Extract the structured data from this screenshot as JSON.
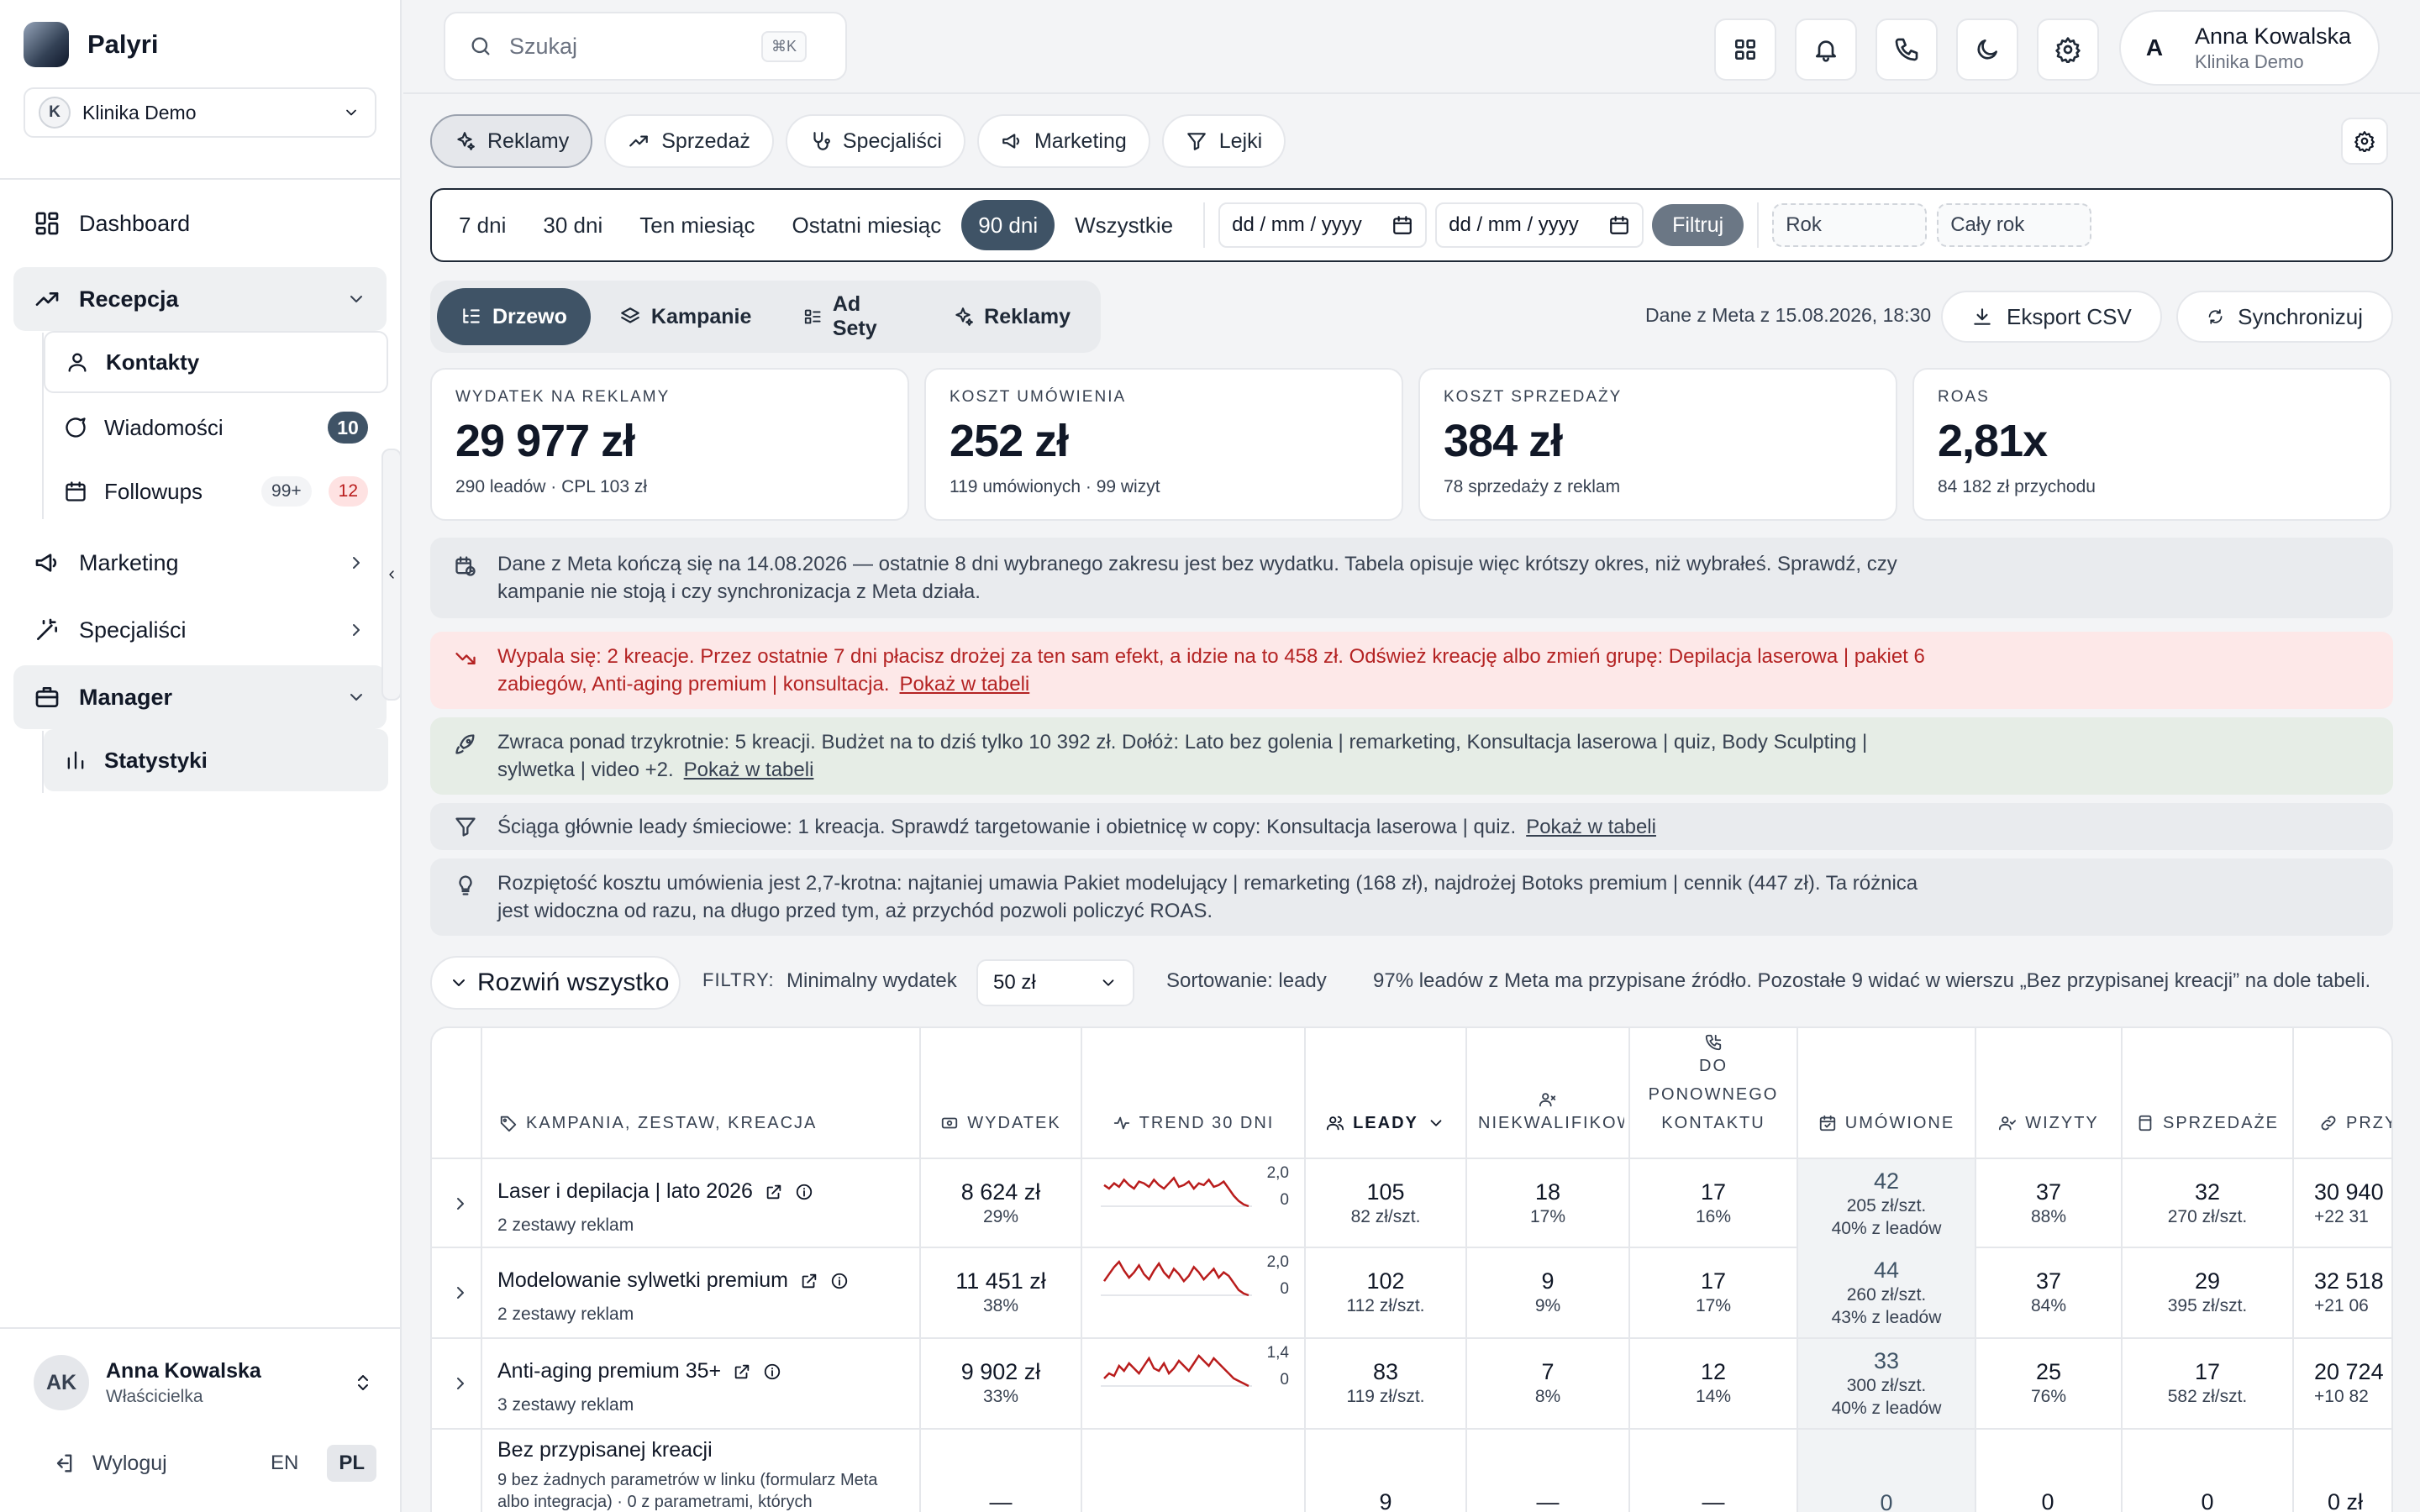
{
  "app": {
    "name": "Palyri",
    "clinic": "Klinika Demo",
    "clinic_initial": "K"
  },
  "sidebar": {
    "dashboard": "Dashboard",
    "recepcja": "Recepcja",
    "kontakty": "Kontakty",
    "wiadomosci": "Wiadomości",
    "wiadomosci_badge": "10",
    "followups": "Followups",
    "followups_badge_1": "99+",
    "followups_badge_2": "12",
    "marketing": "Marketing",
    "specjalisci": "Specjaliści",
    "manager": "Manager",
    "statystyki": "Statystyki",
    "user": {
      "initials": "AK",
      "name": "Anna Kowalska",
      "role": "Właścicielka"
    },
    "logout": "Wyloguj",
    "lang_en": "EN",
    "lang_pl": "PL"
  },
  "topbar": {
    "search_placeholder": "Szukaj",
    "search_kbd": "⌘K",
    "user_initial": "A",
    "user_name": "Anna Kowalska",
    "user_clinic": "Klinika Demo"
  },
  "section_tabs": [
    "Reklamy",
    "Sprzedaż",
    "Specjaliści",
    "Marketing",
    "Lejki"
  ],
  "date_filter": {
    "ranges": [
      "7 dni",
      "30 dni",
      "Ten miesiąc",
      "Ostatni miesiąc",
      "90 dni",
      "Wszystkie"
    ],
    "active_range": "90 dni",
    "date_from": "dd / mm / yyyy",
    "date_to": "dd / mm / yyyy",
    "filter_btn": "Filtruj",
    "year_placeholder": "Rok",
    "period_placeholder": "Cały rok"
  },
  "view_tabs": [
    "Drzewo",
    "Kampanie",
    "Ad Sety",
    "Reklamy"
  ],
  "meta_info": "Dane z Meta z 15.08.2026, 18:30",
  "export_btn": "Eksport CSV",
  "sync_btn": "Synchronizuj",
  "kpis": [
    {
      "title": "WYDATEK NA REKLAMY",
      "value": "29 977 zł",
      "sub": "290 leadów · CPL 103 zł"
    },
    {
      "title": "KOSZT UMÓWIENIA",
      "value": "252 zł",
      "sub": "119 umówionych · 99 wizyt"
    },
    {
      "title": "KOSZT SPRZEDAŻY",
      "value": "384 zł",
      "sub": "78 sprzedaży z reklam"
    },
    {
      "title": "ROAS",
      "value": "2,81x",
      "sub": "84 182 zł przychodu"
    }
  ],
  "alerts": {
    "meta_end": "Dane z Meta kończą się na 14.08.2026 — ostatnie 8 dni wybranego zakresu jest bez wydatku. Tabela opisuje więc krótszy okres, niż wybrałeś. Sprawdź, czy kampanie nie stoją i czy synchronizacja z Meta działa.",
    "burnout": "Wypala się: 2 kreacje. Przez ostatnie 7 dni płacisz drożej za ten sam efekt, a idzie na to 458 zł. Odśwież kreację albo zmień grupę: Depilacja laserowa | pakiet 6 zabiegów, Anti-aging premium | konsultacja.",
    "winners": "Zwraca ponad trzykrotnie: 5 kreacji. Budżet na to dziś tylko 10 392 zł. Dołóż: Lato bez golenia | remarketing, Konsultacja laserowa | quiz, Body Sculpting | sylwetka | video +2.",
    "junk": "Ściąga głównie leady śmieciowe: 1 kreacja. Sprawdź targetowanie i obietnicę w copy: Konsultacja laserowa | quiz.",
    "spread": "Rozpiętość kosztu umówienia jest 2,7-krotna: najtaniej umawia Pakiet modelujący | remarketing (168 zł), najdrożej Botoks premium | cennik (447 zł). Ta różnica jest widoczna od razu, na długo przed tym, aż przychód pozwoli policzyć ROAS.",
    "link": "Pokaż w tabeli"
  },
  "table_controls": {
    "expand_all": "Rozwiń wszystko",
    "filters_label": "FILTRY:",
    "min_spend_label": "Minimalny wydatek",
    "min_spend_value": "50 zł",
    "sorting": "Sortowanie: leady",
    "attribution_note": "97% leadów z Meta ma przypisane źródło. Pozostałe 9 widać w wierszu „Bez przypisanej kreacji” na dole tabeli."
  },
  "table": {
    "headers": {
      "name": "KAMPANIA, ZESTAW, KREACJA",
      "spend": "WYDATEK",
      "trend": "TREND 30 DNI",
      "leads": "LEADY",
      "unqualified": "NIEKWALIFIKOWA",
      "recontact": "DO PONOWNEGO KONTAKTU",
      "booked": "UMÓWIONE",
      "visits": "WIZYTY",
      "sales": "SPRZEDAŻE",
      "revenue": "PRZYCHÓD"
    },
    "rows": [
      {
        "name": "Laser i depilacja | lato 2026",
        "sub": "2 zestawy reklam",
        "spend": "8 624 zł",
        "spend_pct": "29%",
        "trend_max": "2,0",
        "trend_min": "0",
        "trend": [
          1.2,
          1.0,
          1.3,
          1.1,
          1.5,
          1.2,
          1.0,
          1.4,
          1.3,
          1.1,
          1.5,
          1.2,
          1.0,
          1.3,
          1.6,
          1.1,
          1.2,
          1.4,
          1.0,
          1.3,
          1.2,
          1.5,
          1.1,
          1.2,
          1.4,
          1.0,
          0.6,
          0.3,
          0.1,
          0.0
        ],
        "leads": "105",
        "leads_cpl": "82 zł/szt.",
        "unq": "18",
        "unq_pct": "17%",
        "rec": "17",
        "rec_pct": "16%",
        "booked": "42",
        "booked_cost": "205 zł/szt.",
        "booked_pct": "40% z leadów",
        "visits": "37",
        "visits_pct": "88%",
        "sales": "32",
        "sales_cost": "270 zł/szt.",
        "rev": "30 940",
        "rev_sub": "+22 31"
      },
      {
        "name": "Modelowanie sylwetki premium",
        "sub": "2 zestawy reklam",
        "spend": "11 451 zł",
        "spend_pct": "38%",
        "trend_max": "2,0",
        "trend_min": "0",
        "trend": [
          0.8,
          1.2,
          1.6,
          1.9,
          1.4,
          1.0,
          1.3,
          1.7,
          1.2,
          0.9,
          1.4,
          1.8,
          1.3,
          1.0,
          1.5,
          1.2,
          0.8,
          1.1,
          1.6,
          1.3,
          0.9,
          1.2,
          1.5,
          1.0,
          1.3,
          1.1,
          0.7,
          0.3,
          0.1,
          0.0
        ],
        "leads": "102",
        "leads_cpl": "112 zł/szt.",
        "unq": "9",
        "unq_pct": "9%",
        "rec": "17",
        "rec_pct": "17%",
        "booked": "44",
        "booked_cost": "260 zł/szt.",
        "booked_pct": "43% z leadów",
        "visits": "37",
        "visits_pct": "84%",
        "sales": "29",
        "sales_cost": "395 zł/szt.",
        "rev": "32 518",
        "rev_sub": "+21 06"
      },
      {
        "name": "Anti-aging premium 35+",
        "sub": "3 zestawy reklam",
        "spend": "9 902 zł",
        "spend_pct": "33%",
        "trend_max": "1,4",
        "trend_min": "0",
        "trend": [
          0.3,
          0.5,
          0.4,
          0.8,
          0.6,
          0.9,
          0.7,
          0.5,
          0.8,
          1.1,
          0.7,
          0.6,
          0.9,
          0.5,
          0.7,
          1.0,
          0.8,
          0.6,
          0.9,
          1.2,
          1.0,
          0.8,
          1.1,
          0.9,
          0.7,
          0.5,
          0.3,
          0.2,
          0.1,
          0.0
        ],
        "leads": "83",
        "leads_cpl": "119 zł/szt.",
        "unq": "7",
        "unq_pct": "8%",
        "rec": "12",
        "rec_pct": "14%",
        "booked": "33",
        "booked_cost": "300 zł/szt.",
        "booked_pct": "40% z leadów",
        "visits": "25",
        "visits_pct": "76%",
        "sales": "17",
        "sales_cost": "582 zł/szt.",
        "rev": "20 724",
        "rev_sub": "+10 82"
      }
    ],
    "unattributed": {
      "name": "Bez przypisanej kreacji",
      "sub": "9 bez żadnych parametrów w linku (formularz Meta albo integracja) · 0 z parametrami, których",
      "spend": "—",
      "leads": "9",
      "unq": "—",
      "rec": "—",
      "booked": "0",
      "visits": "0",
      "sales": "0",
      "rev": "0 zł"
    }
  },
  "colors": {
    "accent": "#3f5366",
    "trend_line": "#b91c1c",
    "alert_red": "#b42323"
  }
}
